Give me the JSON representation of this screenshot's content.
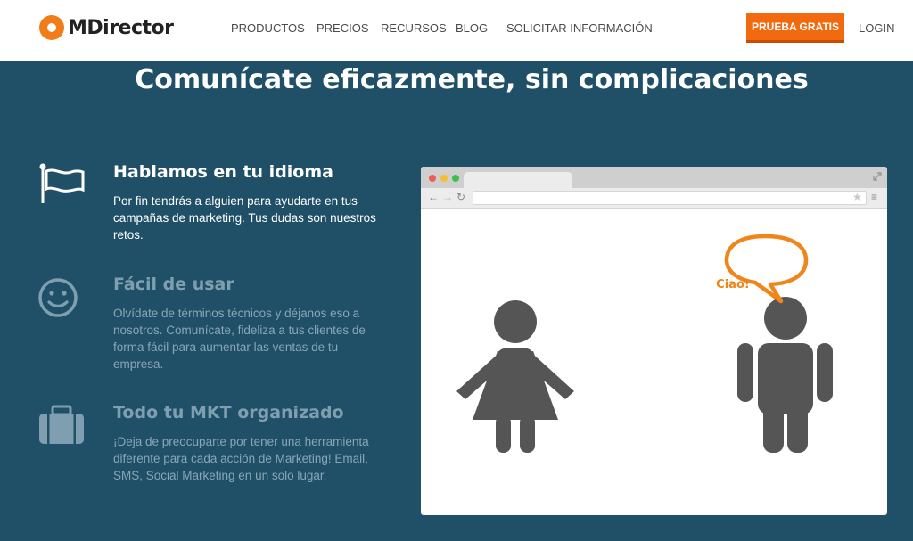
{
  "header": {
    "brand": "MDirector",
    "nav": [
      "PRODUCTOS",
      "PRECIOS",
      "RECURSOS",
      "BLOG",
      "SOLICITAR INFORMACIÓN"
    ],
    "cta_label": "PRUEBA GRATIS",
    "login_label": "LOGIN"
  },
  "hero": {
    "title": "Comunícate eficazmente, sin complicaciones"
  },
  "features": [
    {
      "title": "Hablamos en tu idioma",
      "description": "Por fin tendrás a alguien para ayudarte en tus campañas de marketing. Tus dudas son nuestros retos.",
      "icon": "flag-icon"
    },
    {
      "title": "Fácil de usar",
      "description": "Olvídate de términos técnicos y déjanos eso a nosotros. Comunícate, fideliza a tus clientes de forma fácil para aumentar las ventas de tu empresa.",
      "icon": "smiley-icon"
    },
    {
      "title": "Todo tu MKT organizado",
      "description": "¡Deja de preocuparte por tener una herramienta diferente para cada acción de Marketing! Email, SMS, Social Marketing en un solo lugar.",
      "icon": "briefcase-icon"
    }
  ],
  "illustration": {
    "speech_text": "Ciao!"
  },
  "colors": {
    "background": "#1f5068",
    "accent": "#f26a10",
    "figure": "#555555"
  }
}
